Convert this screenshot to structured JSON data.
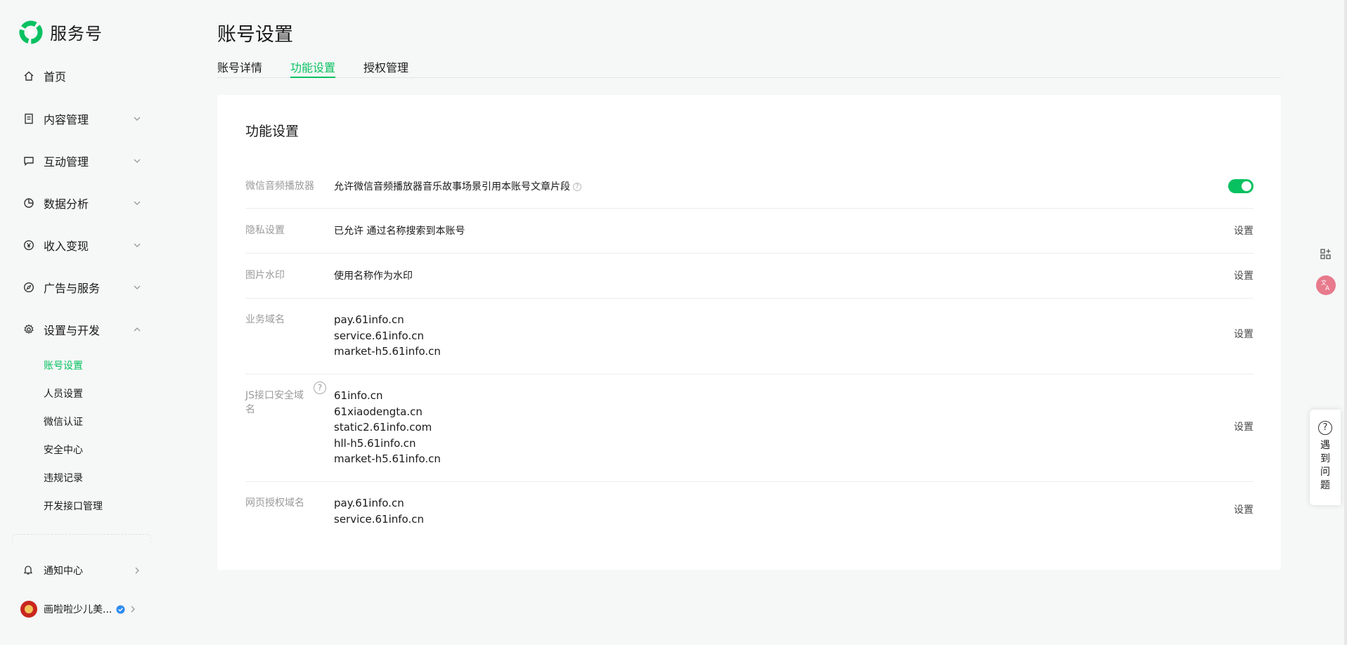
{
  "brand": {
    "name": "服务号"
  },
  "sidebar": {
    "nav": [
      {
        "label": "首页",
        "icon": "home-icon"
      },
      {
        "label": "内容管理",
        "icon": "document-icon"
      },
      {
        "label": "互动管理",
        "icon": "chat-icon"
      },
      {
        "label": "数据分析",
        "icon": "pie-chart-icon"
      },
      {
        "label": "收入变现",
        "icon": "yen-icon"
      },
      {
        "label": "广告与服务",
        "icon": "compass-icon"
      },
      {
        "label": "设置与开发",
        "icon": "gear-icon"
      }
    ],
    "sub_items": [
      {
        "label": "账号设置",
        "active": true
      },
      {
        "label": "人员设置"
      },
      {
        "label": "微信认证"
      },
      {
        "label": "安全中心"
      },
      {
        "label": "违规记录"
      },
      {
        "label": "开发接口管理"
      }
    ],
    "notify": {
      "label": "通知中心",
      "icon": "bell-icon"
    },
    "account": {
      "name": "画啦啦少儿美..."
    }
  },
  "page": {
    "title": "账号设置",
    "tabs": [
      {
        "label": "账号详情"
      },
      {
        "label": "功能设置",
        "active": true
      },
      {
        "label": "授权管理"
      }
    ]
  },
  "card": {
    "title": "功能设置",
    "action_label": "设置",
    "rows": [
      {
        "label": "微信音频播放器",
        "value": "允许微信音频播放器音乐故事场景引用本账号文章片段",
        "toggle_on": true
      },
      {
        "label": "隐私设置",
        "value": "已允许 通过名称搜索到本账号"
      },
      {
        "label": "图片水印",
        "value": "使用名称作为水印"
      },
      {
        "label": "业务域名",
        "domains": [
          "pay.61info.cn",
          "service.61info.cn",
          "market-h5.61info.cn"
        ]
      },
      {
        "label_line1": "JS接口安全域",
        "label_line2": "名",
        "domains": [
          "61info.cn",
          "61xiaodengta.cn",
          "static2.61info.com",
          "hll-h5.61info.cn",
          "market-h5.61info.cn"
        ]
      },
      {
        "label": "网页授权域名",
        "domains": [
          "pay.61info.cn",
          "service.61info.cn"
        ]
      }
    ]
  },
  "help_panel": {
    "text": "遇到问题"
  },
  "colors": {
    "accent": "#07c160",
    "background": "#f6f7f7"
  }
}
